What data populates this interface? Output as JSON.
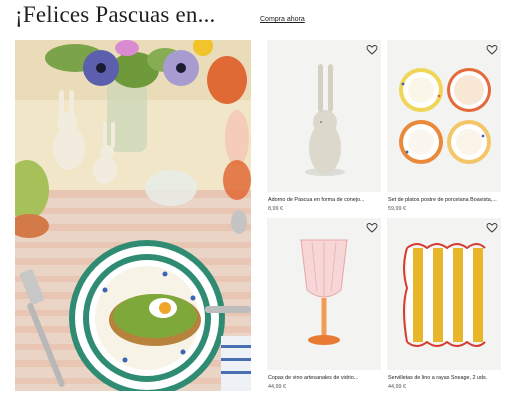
{
  "header": {
    "title": "¡Felices Pascuas en...",
    "link": "Compra ahora"
  },
  "colors": {
    "card_bg": "#f3f3f2",
    "text": "#222222",
    "price": "#555555"
  },
  "products": [
    {
      "name": "Adorno de Pascua en forma de conejo...",
      "price": "8,99 €",
      "icon": "heart-icon"
    },
    {
      "name": "Set de platos postre de porcelana Boavista,...",
      "price": "59,99 €",
      "icon": "heart-icon"
    },
    {
      "name": "Copas de vino artesanales de vidrio...",
      "price": "44,99 €",
      "icon": "heart-icon"
    },
    {
      "name": "Servilletas de lino a rayas Sneage, 2 uds.",
      "price": "44,99 €",
      "icon": "heart-icon"
    }
  ]
}
